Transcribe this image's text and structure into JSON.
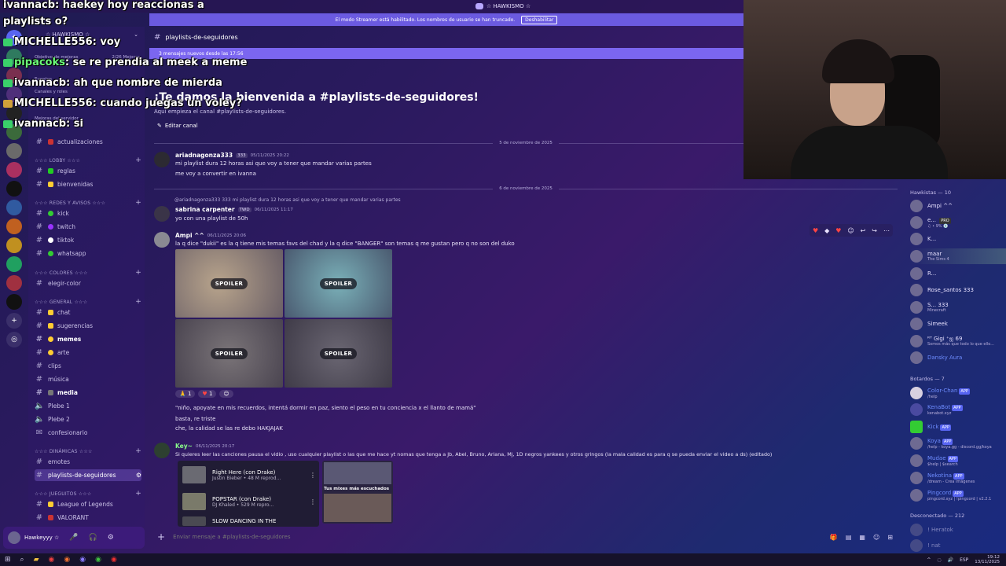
{
  "titlebar": {
    "title": "☆ HAWKISMO ☆"
  },
  "streamer_banner": {
    "text": "El modo Streamer está habilitado. Los nombres de usuario se han truncado.",
    "button": "Deshabilitar"
  },
  "guild": {
    "name": "☆ HAWKISMO ☆",
    "boost_label": "Objetivo de mejoras",
    "boost_count": "2/26 Mejoras",
    "events": "Eventos",
    "channels_roles": "Canales y roles",
    "server_upgrades": "Mejoras del servidor"
  },
  "sidebar": {
    "top_channel": "actualizaciones",
    "categories": [
      {
        "name": "☆☆☆ LOBBY ☆☆☆",
        "channels": [
          "reglas",
          "bienvenidas"
        ]
      },
      {
        "name": "☆☆☆ REDES Y AVISOS ☆☆☆",
        "channels": [
          "kick",
          "twitch",
          "tiktok",
          "whatsapp"
        ]
      },
      {
        "name": "☆☆☆ COLORES ☆☆☆",
        "channels": [
          "elegir-color"
        ]
      },
      {
        "name": "☆☆☆ GENERAL ☆☆☆",
        "channels": [
          "chat",
          "sugerencias",
          "memes",
          "arte",
          "clips",
          "música",
          "media",
          "Plebe 1",
          "Plebe 2",
          "confesionario"
        ]
      },
      {
        "name": "☆☆☆ DINÁMICAS ☆☆☆",
        "channels": [
          "emotes",
          "playlists-de-seguidores"
        ]
      },
      {
        "name": "☆☆☆ JUEGUITOS ☆☆☆",
        "channels": [
          "League of Legends",
          "VALORANT"
        ]
      }
    ]
  },
  "user_panel": {
    "name": "Hawkeyyy ☆",
    "status": "☆"
  },
  "chat": {
    "channel_name": "playlists-de-seguidores",
    "new_messages": "3 mensajes nuevos desde las 17:56",
    "welcome_title": "¡Te damos la bienvenida a #playlists-de-seguidores!",
    "welcome_sub": "Aquí empieza el canal #playlists-de-seguidores.",
    "edit_channel": "Editar canal",
    "date1": "5 de noviembre de 2025",
    "date2": "6 de noviembre de 2025",
    "messages": [
      {
        "author": "ariadnagonza333",
        "tag": "333",
        "time": "05/11/2025 20:22",
        "lines": [
          "mi playlist dura 12 horas asi que voy a tener que mandar varias partes",
          "me voy a convertir en ivanna"
        ]
      },
      {
        "reply": "@ariadnagonza333 333 mi playlist dura 12 horas asi que voy a tener que mandar varias partes",
        "author": "sabrina carpenter",
        "tag": "TWD",
        "time": "06/11/2025 11:17",
        "lines": [
          "yo con una playlist de 50h"
        ]
      },
      {
        "author": "Ampi ^^",
        "tag": "",
        "time": "06/11/2025 20:06",
        "lines": [
          "la q dice \"dukii\" es la q tiene mis temas favs del chad y la q dice \"BANGER\" son temas q me gustan pero q no son del duko"
        ],
        "spoiler_label": "SPOILER",
        "reactions": [
          "1",
          "1"
        ],
        "after": [
          "\"niño, apoyate en mis recuerdos, intentá dormir en paz, siento el peso en tu conciencia x el llanto de mamá\"",
          "basta, re triste",
          "che, la calidad se las re debo HAKJAJAK"
        ]
      },
      {
        "author": "Key~",
        "tag": "",
        "time": "06/11/2025 20:17",
        "lines": [
          "Si quieres leer las canciones pausa el vidio , uso cualquier playlist o las que me hace yt nomas que tenga a Jb, Abel, Bruno, Ariana, Mj, 1D  negros yankees y otros gringos (la mala calidad es para q se pueda enviar el video a ds) (editado)"
        ]
      }
    ],
    "yt": [
      {
        "title": "Right Here (con Drake)",
        "sub": "Justin Bieber • 48 M reprod..."
      },
      {
        "title": "POPSTAR (con Drake)",
        "sub": "DJ Khaled • 529 M repro..."
      },
      {
        "title": "SLOW DANCING IN THE",
        "sub": ""
      }
    ],
    "yt_side_caption": "Tus mixes más escuchados",
    "composer_placeholder": "Enviar mensaje a #playlists-de-seguidores"
  },
  "members": {
    "online_header": "Hawkistas — 10",
    "online": [
      {
        "name": "Ampi ^^",
        "status": ""
      },
      {
        "name": "e...",
        "status": "♫ • 9% 💿",
        "tag": "PRO"
      },
      {
        "name": "K...",
        "status": ""
      },
      {
        "name": "maar",
        "status": "The Sims 4"
      },
      {
        "name": "R...",
        "status": ""
      },
      {
        "name": "Rose_santos",
        "status": "",
        "tag": "333"
      },
      {
        "name": "S...",
        "status": "Minecraft",
        "tag": "333"
      },
      {
        "name": "Simeek",
        "status": ""
      },
      {
        "name": "ᴿᵀ Gigi ⁺ஐ",
        "status": "Somos más que todo lo que ello...",
        "tag": "69"
      },
      {
        "name": "Dansky",
        "status": "",
        "tag": "Aura"
      }
    ],
    "bots_header": "Botardos — 7",
    "bots": [
      {
        "name": "Color-Chan",
        "status": "/help"
      },
      {
        "name": "KenaBot",
        "status": "kenabot.xyz"
      },
      {
        "name": "Kick",
        "status": ""
      },
      {
        "name": "Koya",
        "status": "/help - koya.gg - discord.gg/koya"
      },
      {
        "name": "Mudae",
        "status": "$help | $search"
      },
      {
        "name": "Nekotina",
        "status": "/dream - Crea imágenes"
      },
      {
        "name": "Pingcord",
        "status": "pingcord.xyz | !pingcord | v2.2.1"
      }
    ],
    "app_badge": "APP",
    "offline_header": "Desconectado — 212",
    "offline": [
      "! Heratok",
      "! nat"
    ]
  },
  "overlay_chat": [
    {
      "user": "ivannacb",
      "text": ": haekey hoy reaccionas a"
    },
    {
      "user": "",
      "text": "playlists o?"
    },
    {
      "user": "MICHELLE556",
      "text": ": voy"
    },
    {
      "user": "pipacoks",
      "text": ": se re prendia al meek a meme",
      "green": true
    },
    {
      "user": "ivannacb",
      "text": ": ah que nombre de mierda"
    },
    {
      "user": "MICHELLE556",
      "text": ": cuando juegas un voley?"
    },
    {
      "user": "ivannacb",
      "text": ": si"
    }
  ],
  "taskbar": {
    "lang": "ESP",
    "time": "19:12",
    "date": "13/11/2025"
  },
  "colors": {
    "accent": "#7b66f0",
    "banner": "#6b5ae0",
    "app_badge": "#5865f2"
  }
}
